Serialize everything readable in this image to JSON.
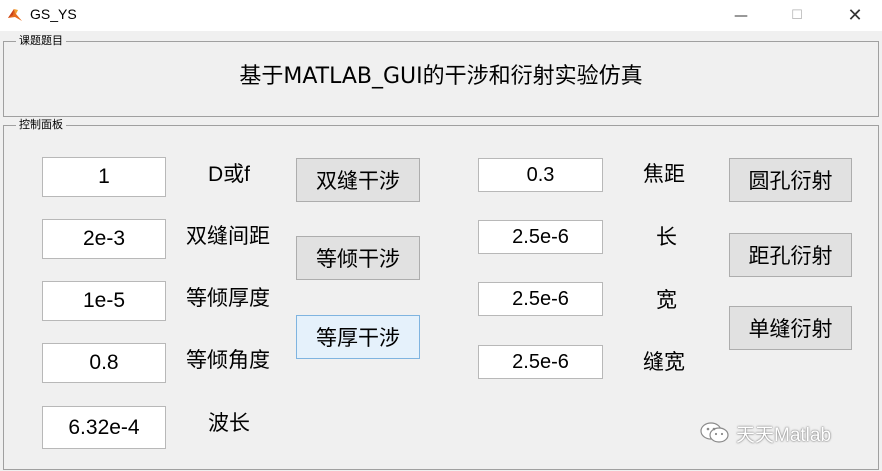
{
  "window": {
    "title": "GS_YS",
    "minimize_glyph": "—",
    "maximize_glyph": "☐",
    "close_glyph": "✕"
  },
  "topic_panel": {
    "legend": "课题题目",
    "text": "基于MATLAB_GUI的干涉和衍射实验仿真"
  },
  "control_panel": {
    "legend": "控制面板",
    "left_fields": [
      {
        "value": "1",
        "label": "D或f"
      },
      {
        "value": "2e-3",
        "label": "双缝间距"
      },
      {
        "value": "1e-5",
        "label": "等倾厚度"
      },
      {
        "value": "0.8",
        "label": "等倾角度"
      },
      {
        "value": "6.32e-4",
        "label": "波长"
      }
    ],
    "interference_buttons": [
      "双缝干涉",
      "等倾干涉",
      "等厚干涉"
    ],
    "right_fields": [
      {
        "value": "0.3",
        "label": "焦距"
      },
      {
        "value": "2.5e-6",
        "label": "长"
      },
      {
        "value": "2.5e-6",
        "label": "宽"
      },
      {
        "value": "2.5e-6",
        "label": "缝宽"
      }
    ],
    "diffraction_buttons": [
      "圆孔衍射",
      "距孔衍射",
      "单缝衍射"
    ]
  },
  "watermark": {
    "text": "天天Matlab",
    "icon": "wechat-icon"
  }
}
